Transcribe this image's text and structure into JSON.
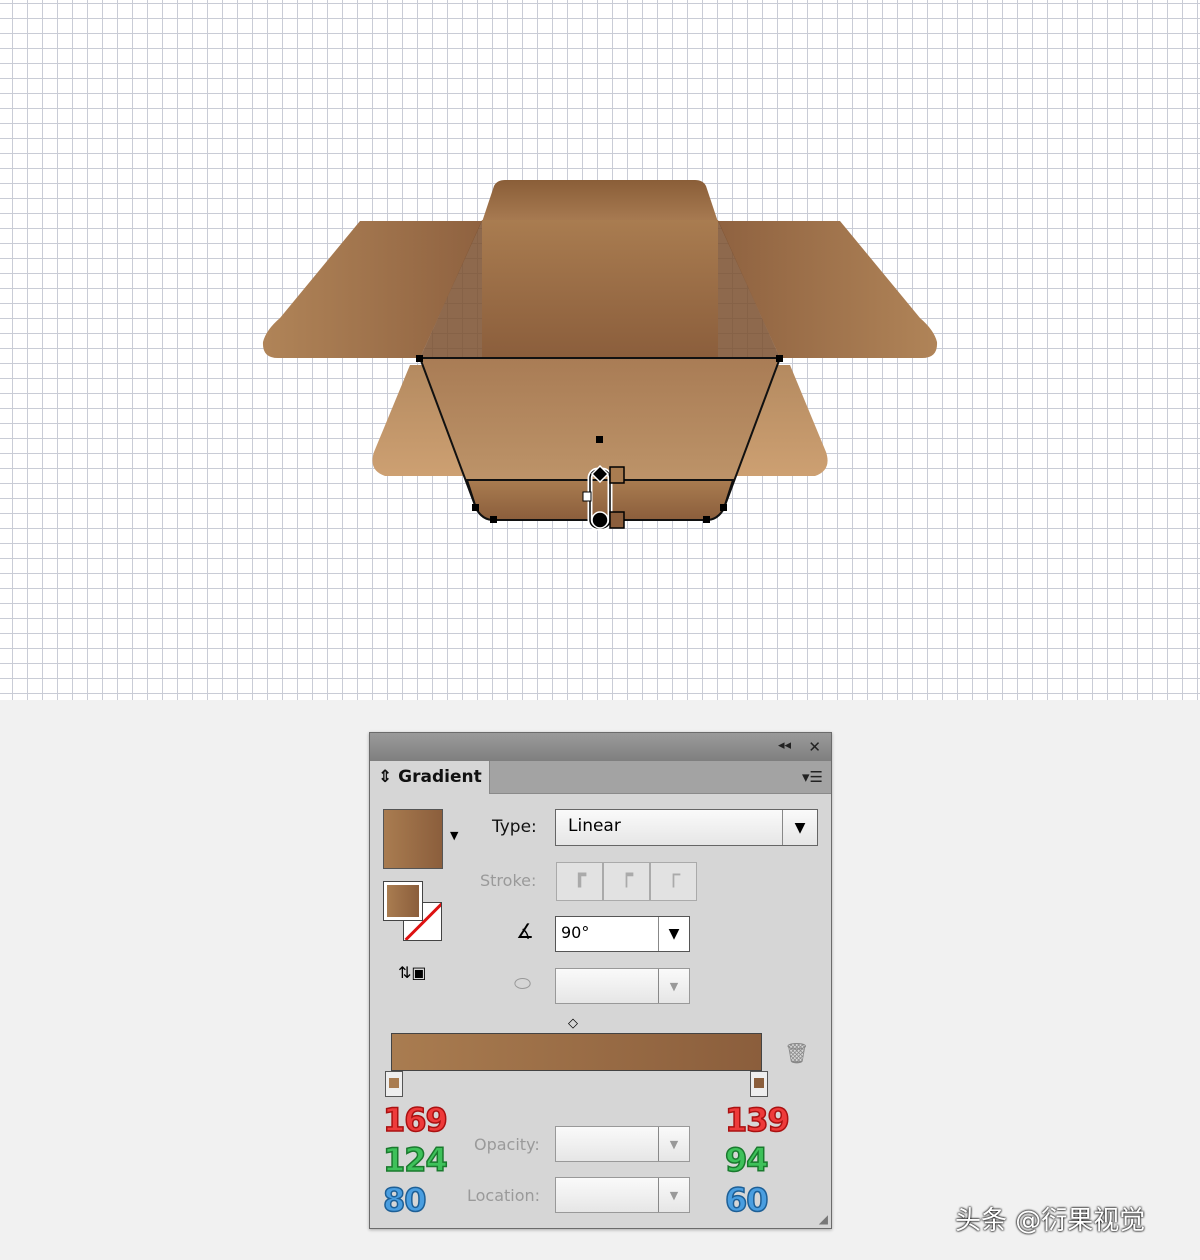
{
  "canvas": {
    "grid": true,
    "gradient_start": "#a97c50",
    "gradient_end": "#8b5e3c"
  },
  "panel": {
    "collapse_icon": "double-chevron-left-icon",
    "close_icon": "close-icon",
    "tab_label": "Gradient",
    "menu_icon": "panel-menu-icon",
    "type_label": "Type:",
    "type_value": "Linear",
    "stroke_label": "Stroke:",
    "angle_value": "90°",
    "opacity_label": "Opacity:",
    "location_label": "Location:",
    "stops": [
      {
        "r": "169",
        "g": "124",
        "b": "80",
        "color": "#a97c50"
      },
      {
        "r": "139",
        "g": "94",
        "b": "60",
        "color": "#8b5e3c"
      }
    ]
  },
  "watermark": "头条 @衍果视觉"
}
